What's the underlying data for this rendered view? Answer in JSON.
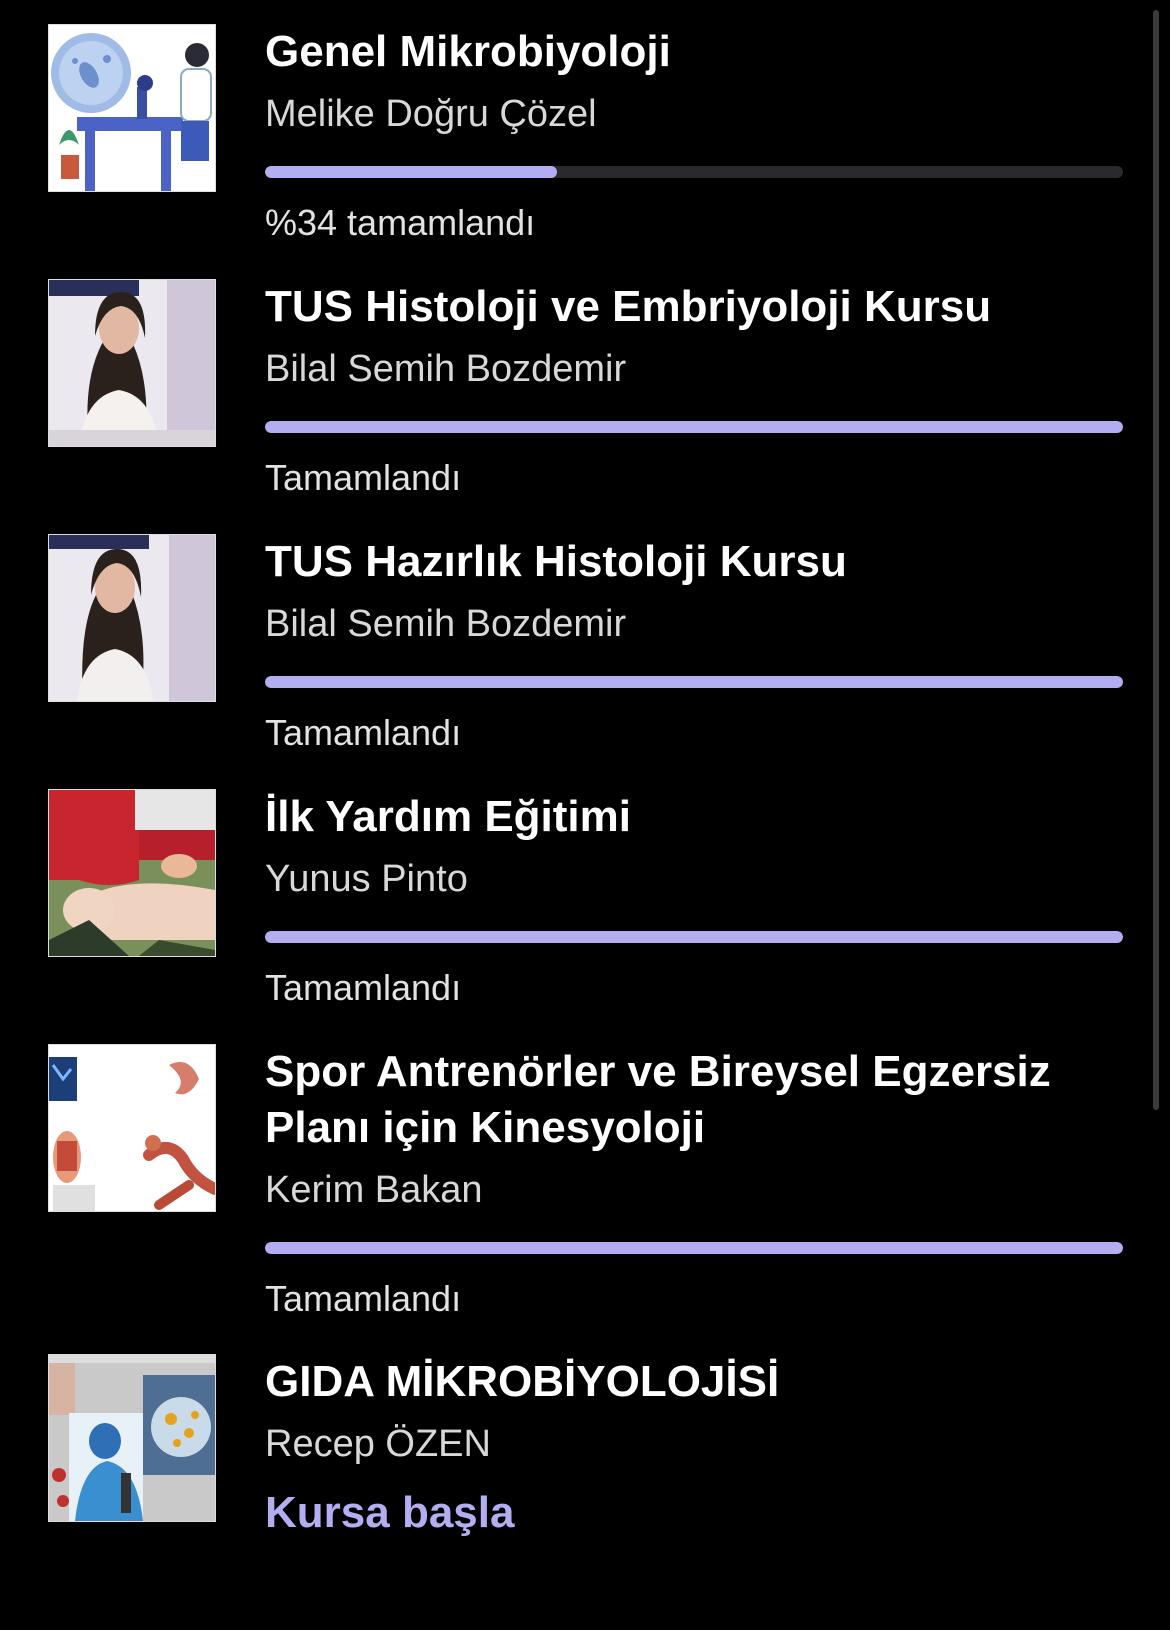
{
  "colors": {
    "accent": "#b3aef2",
    "background": "#000000",
    "track": "#2a2a2e"
  },
  "courses": [
    {
      "title": "Genel Mikrobiyoloji",
      "instructor": "Melike Doğru Çözel",
      "progress": 0.34,
      "status": "%34 tamamlandı",
      "thumbnail": "microbiology-illustration"
    },
    {
      "title": "TUS Histoloji ve Embriyoloji Kursu",
      "instructor": "Bilal Semih Bozdemir",
      "progress": 1.0,
      "status": "Tamamlandı",
      "thumbnail": "presenter-video"
    },
    {
      "title": "TUS Hazırlık Histoloji Kursu",
      "instructor": "Bilal Semih Bozdemir",
      "progress": 1.0,
      "status": "Tamamlandı",
      "thumbnail": "presenter-video"
    },
    {
      "title": "İlk Yardım Eğitimi",
      "instructor": "Yunus Pinto",
      "progress": 1.0,
      "status": "Tamamlandı",
      "thumbnail": "cpr-training-photo"
    },
    {
      "title": "Spor Antrenörler ve Bireysel Egzersiz Planı için Kinesyoloji",
      "instructor": "Kerim Bakan",
      "progress": 1.0,
      "status": "Tamamlandı",
      "thumbnail": "anatomy-collage"
    },
    {
      "title": "GIDA MİKROBİYOLOJİSİ",
      "instructor": "Recep ÖZEN",
      "action": "Kursa başla",
      "thumbnail": "lab-collage"
    }
  ]
}
